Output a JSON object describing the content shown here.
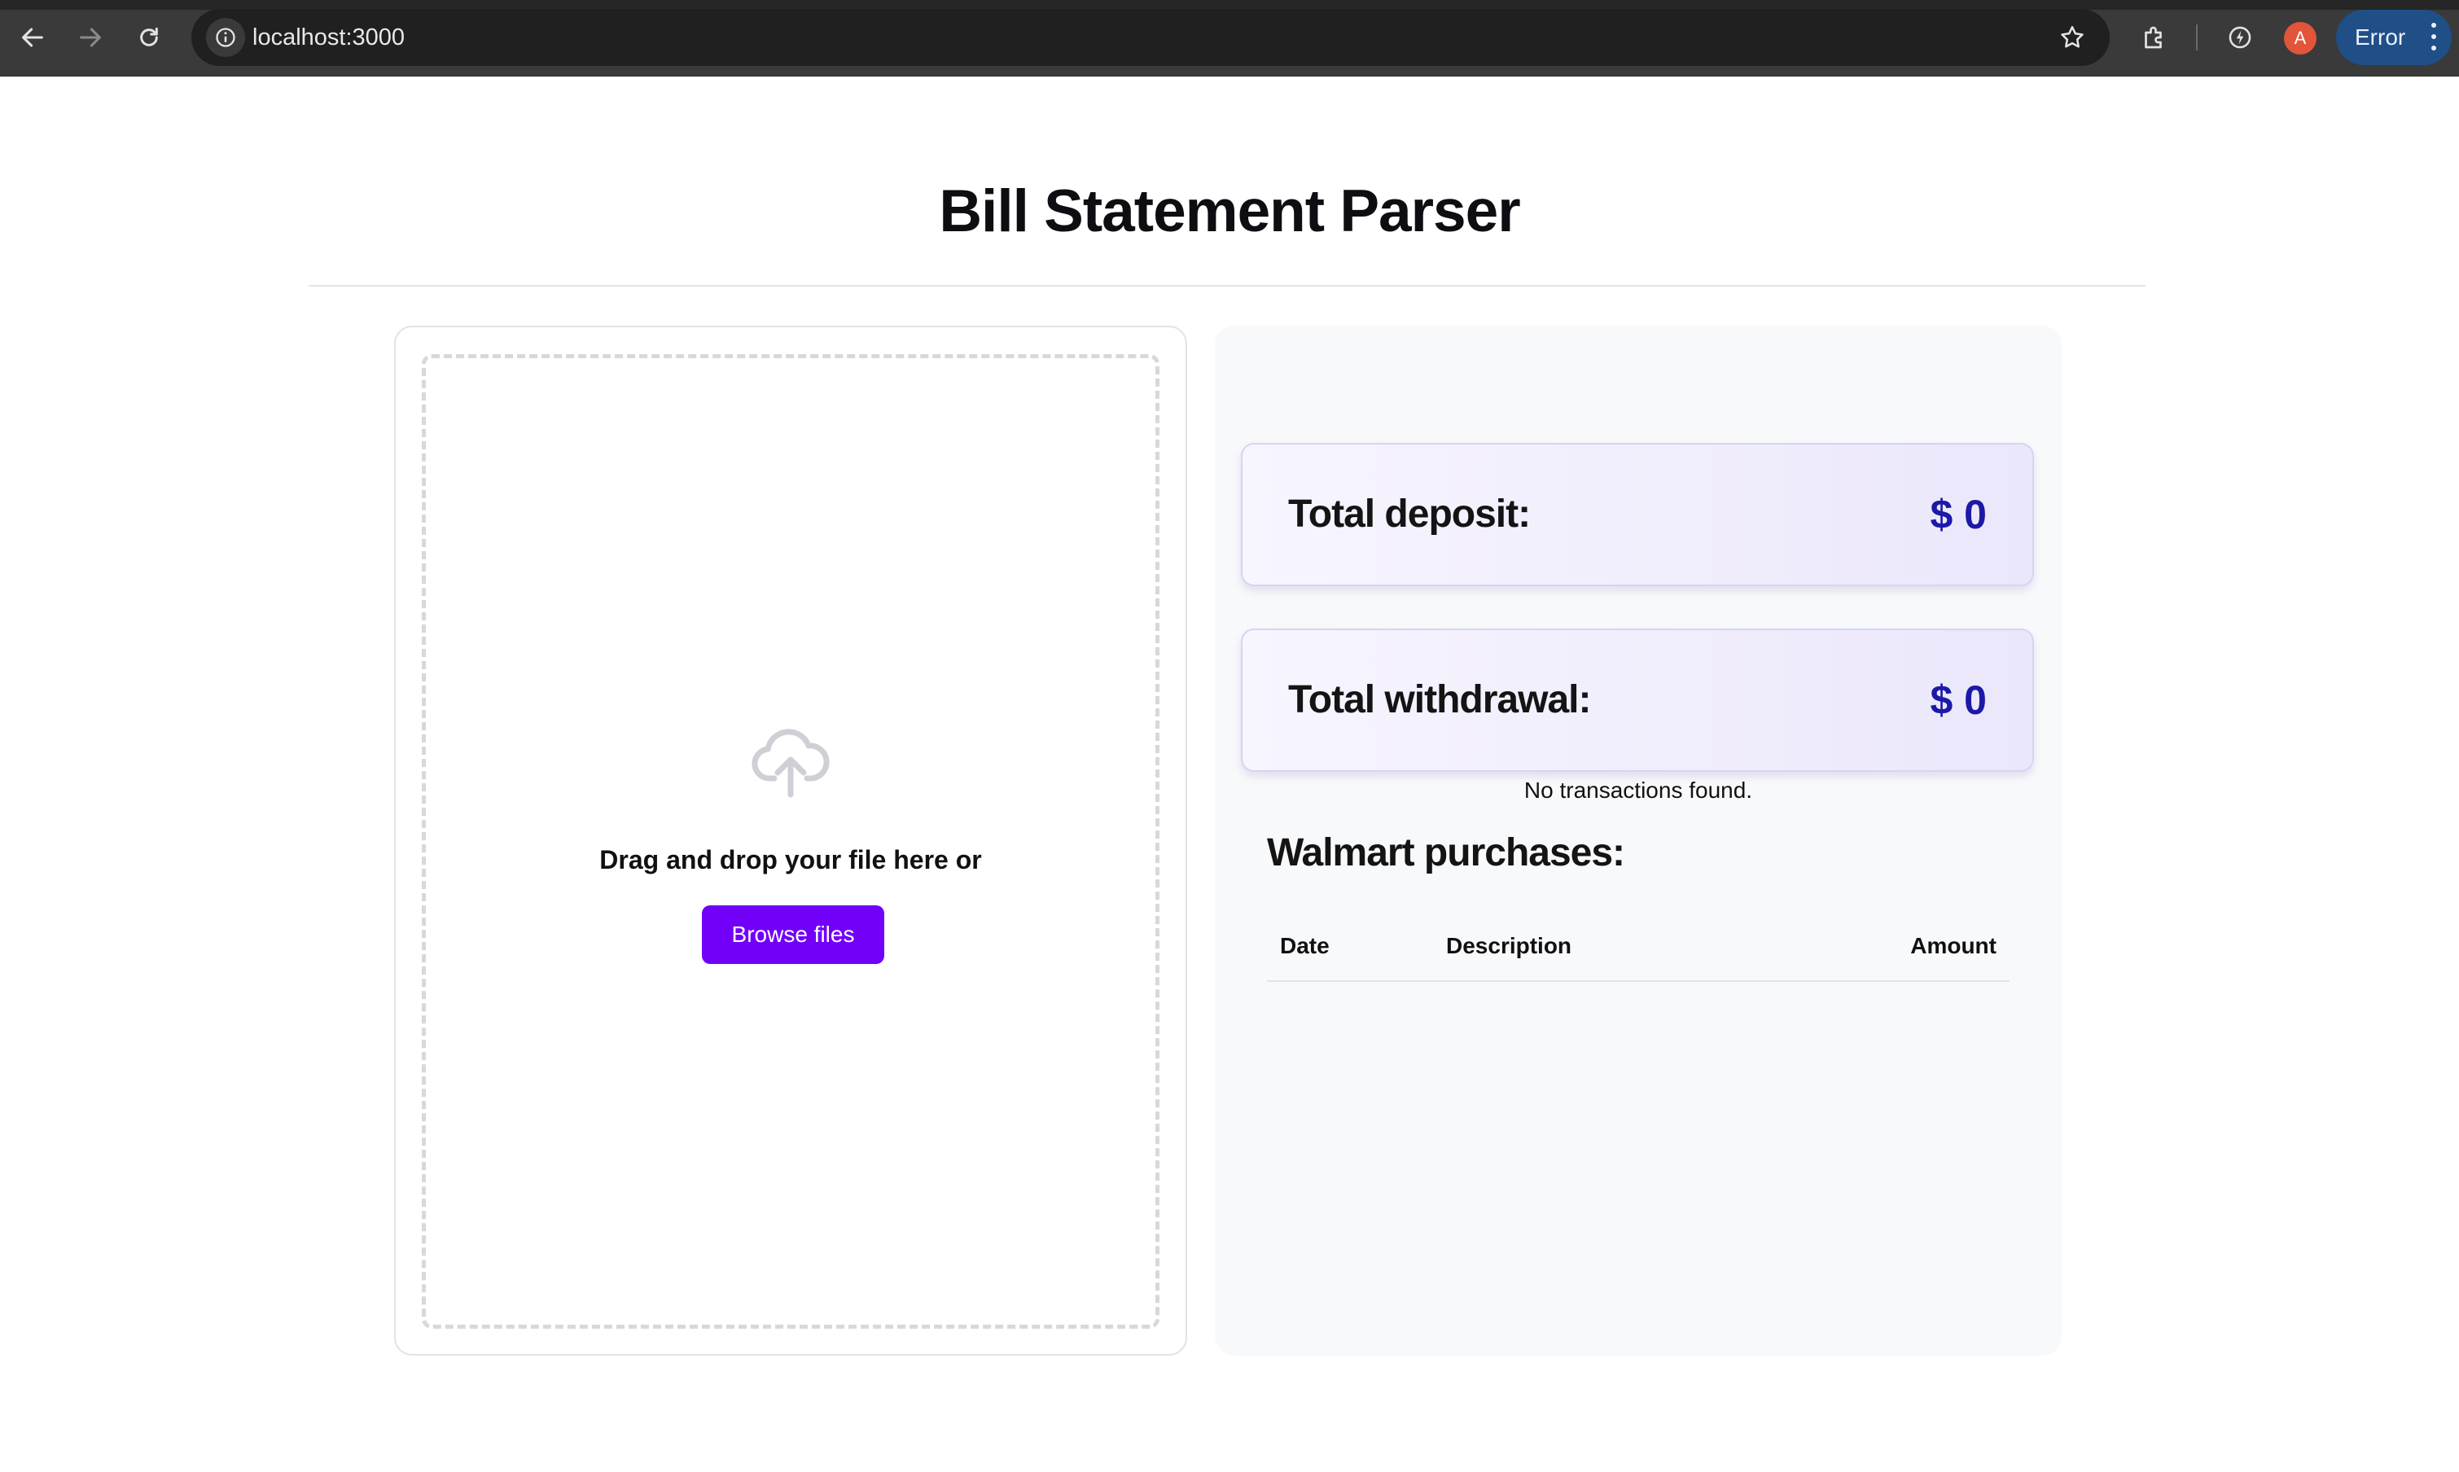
{
  "browser": {
    "url": "localhost:3000",
    "profile_initial": "A",
    "error_label": "Error",
    "icons": [
      "back-icon",
      "forward-icon",
      "reload-icon",
      "site-info-icon",
      "bookmark-star-icon",
      "extensions-icon",
      "performance-icon",
      "kebab-menu-icon"
    ]
  },
  "page": {
    "title": "Bill Statement Parser"
  },
  "upload": {
    "icon": "cloud-upload-icon",
    "prompt": "Drag and drop your file here or",
    "browse_label": "Browse files"
  },
  "summary": {
    "deposit_label": "Total deposit:",
    "deposit_value": "$ 0",
    "withdrawal_label": "Total withdrawal:",
    "withdrawal_value": "$ 0"
  },
  "walmart": {
    "title": "Walmart purchases:",
    "columns": [
      "Date",
      "Description",
      "Amount"
    ],
    "rows": [],
    "empty_text": "No transactions found."
  },
  "colors": {
    "accent": "#7200f9",
    "value_text": "#1b19a6",
    "error_button": "#1f4f86"
  }
}
